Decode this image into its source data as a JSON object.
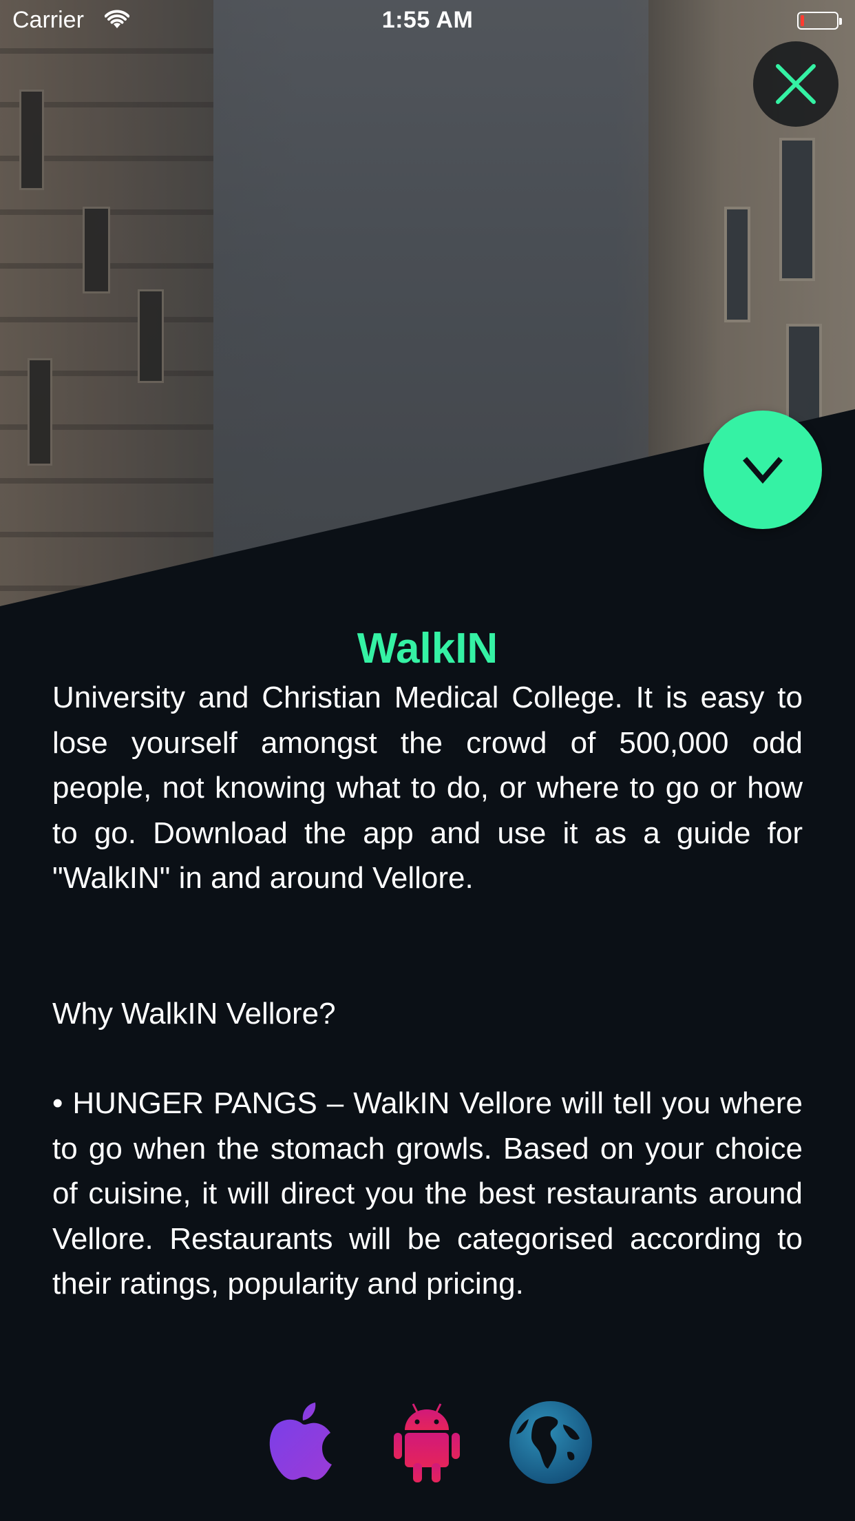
{
  "status_bar": {
    "carrier": "Carrier",
    "time": "1:55 AM",
    "battery_level": 0.1
  },
  "header": {
    "close_icon": "close-x-icon",
    "expand_icon": "chevron-down-icon"
  },
  "colors": {
    "accent": "#35f2a4",
    "background": "#0b1016",
    "battery_low": "#ff3b30"
  },
  "main": {
    "title": "WalkIN",
    "intro": "University and Christian Medical College. It is easy to lose yourself amongst the crowd of 500,000 odd people, not knowing what to do, or where to go or how to go. Download the app and use it as a guide for \"WalkIN\" in and around Vellore.",
    "why_heading": "Why WalkIN Vellore?",
    "hunger_pangs": "• HUNGER PANGS – WalkIN Vellore will tell you where to go when the stomach growls. Based on your choice of cuisine, it will direct you the best restaurants around Vellore. Restaurants will be categorised according to their ratings, popularity and pricing."
  },
  "footer": {
    "icons": [
      "apple-icon",
      "android-icon",
      "globe-icon"
    ]
  }
}
